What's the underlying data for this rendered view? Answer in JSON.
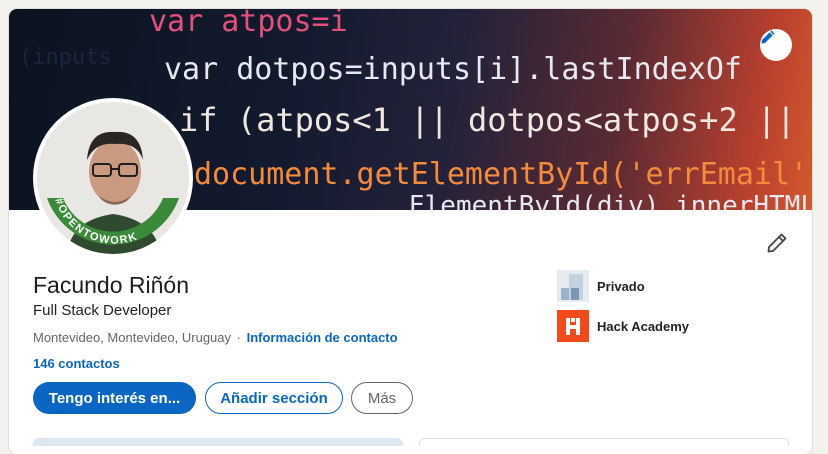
{
  "profile": {
    "name": "Facundo Riñón",
    "headline": "Full Stack Developer",
    "location": "Montevideo, Montevideo, Uruguay",
    "separator": "·",
    "contact_info_label": "Información de contacto",
    "connections": "146 contactos",
    "badge_text": "#OPENTOWORK"
  },
  "banner": {
    "code_lines": [
      "var  atpos=i",
      "var dotpos=inputs[i].lastIndexOf",
      "if (atpos<1 || dotpos<atpos+2 ||",
      "document.getElementById('errEmail');",
      "ElementById(div).innerHTML"
    ],
    "icon": "pencil-icon"
  },
  "actions": {
    "open_to": "Tengo interés en...",
    "add_section": "Añadir sección",
    "more": "Más"
  },
  "experience": [
    {
      "name": "Privado",
      "icon": "private-company-logo"
    },
    {
      "name": "Hack Academy",
      "icon": "hack-academy-logo"
    }
  ],
  "colors": {
    "accent": "#0a66c2",
    "opentowork_green": "#3a8a3a",
    "hack_academy": "#f24a1d"
  }
}
